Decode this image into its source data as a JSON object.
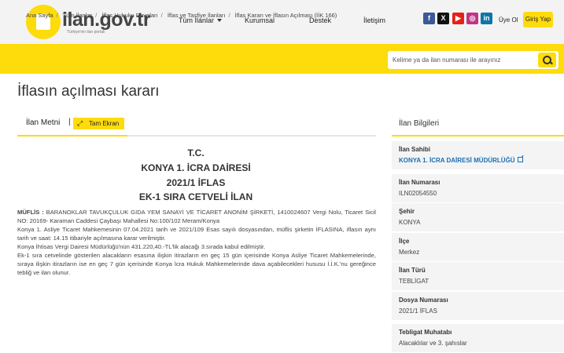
{
  "header": {
    "logo_text": "ilan.gov.tr",
    "logo_sub": "Türkiye'nin ilan portalı",
    "nav": [
      "Tüm İlanlar",
      "Kurumsal",
      "Destek",
      "İletişim"
    ],
    "social": [
      "f",
      "X",
      "▶",
      "◎",
      "in"
    ],
    "signup": "Üye Ol",
    "login": "Giriş Yap"
  },
  "breadcrumb": [
    "Ana Sayfa",
    "Tüm İlanlar",
    "İflas Hukuku Davaları",
    "İflas ve Tasfiye İlanları",
    "İflas Kararı ve İflasın Açılması (İİK 166)"
  ],
  "search": {
    "placeholder": "Kelime ya da ilan numarası ile arayınız"
  },
  "page_title": "İflasın açılması kararı",
  "tabs": {
    "text_tab": "İlan Metni",
    "separator": "|",
    "fullscreen": "Tam Ekran"
  },
  "document": {
    "heading1": "T.C.",
    "heading2": "KONYA 1. İCRA DAİRESİ",
    "heading3": "2021/1 İFLAS",
    "heading4": "EK-1 SIRA CETVELİ İLAN",
    "line1_label": "MÜFLİS :",
    "line1": " BARANOKLAR TAVUKÇULUK GIDA YEM SANAYİ VE TİCARET ANONİM ŞİRKETİ, 1410024607 Vergi Nolu, Ticaret Sicil NO: 20169- Karaman Caddesi Çaybaşı Mahallesi No:100/102 Meram/Konya",
    "para2": "Konya 1. Asliye Ticaret Mahkemesinin 07.04.2021 tarih ve 2021/109 Esas sayılı dosyasından, müflis şirketin İFLASINA, iflasın aynı tarih ve saat: 14.15 itibariyle açılmasına karar verilmiştir.",
    "para3": "Konya İhtisas Vergi Dairesi Müdürlüğü'nün 431.220,40.-TL'lik alacağı 3.sırada kabul edilmiştir.",
    "para4": "Ek-1 sıra cetvelinde gösterilen alacakların esasına ilişkin itirazların en geç 15 gün içerisinde Konya Asliye Ticaret Mahkemelerinde, sıraya ilişkin itirazların ise en geç 7 gün içerisinde Konya İcra Hukuk Mahkemelerinde dava açabilecekleri hususu İ.İ.K.'nu gereğince tebliğ ve ilan olunur."
  },
  "sidebar": {
    "title": "İlan Bilgileri",
    "items": [
      {
        "label": "İlan Sahibi",
        "value": "KONYA 1. İCRA DAİRESİ MÜDÜRLÜĞÜ"
      },
      {
        "label": "İlan Numarası",
        "value": "ILN02054550"
      },
      {
        "label": "Şehir",
        "value": "KONYA"
      },
      {
        "label": "İlçe",
        "value": "Merkez"
      },
      {
        "label": "İlan Türü",
        "value": "TEBLİGAT"
      },
      {
        "label": "Dosya Numarası",
        "value": "2021/1 İFLAS"
      },
      {
        "label": "Tebligat Muhatabı",
        "value": "Alacaklılar ve 3. şahıslar"
      }
    ]
  }
}
